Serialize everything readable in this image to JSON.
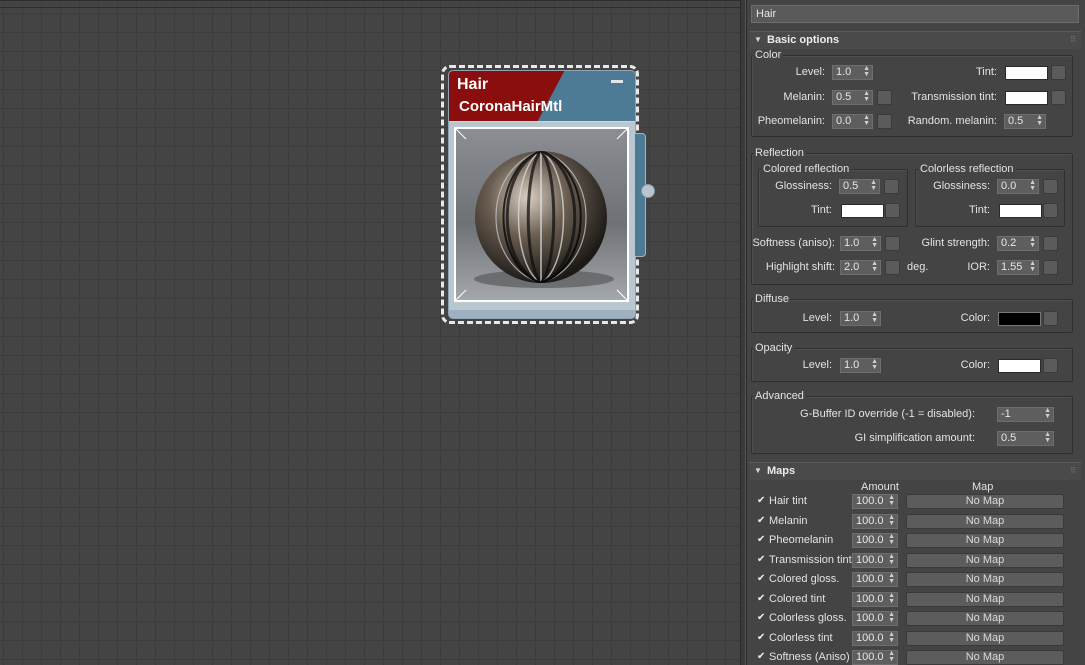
{
  "node": {
    "title": "Hair",
    "type": "CoronaHairMtl"
  },
  "material_name": "Hair",
  "basic": {
    "title": "Basic options",
    "color_group": "Color",
    "level_label": "Level:",
    "level": "1.0",
    "tint_label": "Tint:",
    "melanin_label": "Melanin:",
    "melanin": "0.5",
    "transmission_tint_label": "Transmission tint:",
    "pheomelanin_label": "Pheomelanin:",
    "pheomelanin": "0.0",
    "random_melanin_label": "Random. melanin:",
    "random_melanin": "0.5",
    "reflection_group": "Reflection",
    "colored_reflection": "Colored reflection",
    "colorless_reflection": "Colorless reflection",
    "glossiness_label": "Glossiness:",
    "colored_glossiness": "0.5",
    "colorless_glossiness": "0.0",
    "softness_label": "Softness (aniso):",
    "softness": "1.0",
    "glint_label": "Glint strength:",
    "glint": "0.2",
    "highlight_label": "Highlight shift:",
    "highlight": "2.0",
    "deg": "deg.",
    "ior_label": "IOR:",
    "ior": "1.55",
    "diffuse_group": "Diffuse",
    "diffuse_level_label": "Level:",
    "diffuse_level": "1.0",
    "color_label": "Color:",
    "opacity_group": "Opacity",
    "opacity_level_label": "Level:",
    "opacity_level": "1.0",
    "opacity_color_label": "Color:",
    "advanced_group": "Advanced",
    "gbuffer_label": "G-Buffer ID override (-1 = disabled):",
    "gbuffer": "-1",
    "gi_label": "GI simplification amount:",
    "gi": "0.5"
  },
  "maps": {
    "title": "Maps",
    "amount_header": "Amount",
    "map_header": "Map",
    "rows": [
      {
        "label": "Hair tint",
        "amount": "100.0",
        "map": "No Map"
      },
      {
        "label": "Melanin",
        "amount": "100.0",
        "map": "No Map"
      },
      {
        "label": "Pheomelanin",
        "amount": "100.0",
        "map": "No Map"
      },
      {
        "label": "Transmission tint",
        "amount": "100.0",
        "map": "No Map"
      },
      {
        "label": "Colored gloss.",
        "amount": "100.0",
        "map": "No Map"
      },
      {
        "label": "Colored tint",
        "amount": "100.0",
        "map": "No Map"
      },
      {
        "label": "Colorless gloss.",
        "amount": "100.0",
        "map": "No Map"
      },
      {
        "label": "Colorless tint",
        "amount": "100.0",
        "map": "No Map"
      },
      {
        "label": "Softness (Aniso)",
        "amount": "100.0",
        "map": "No Map"
      }
    ]
  }
}
